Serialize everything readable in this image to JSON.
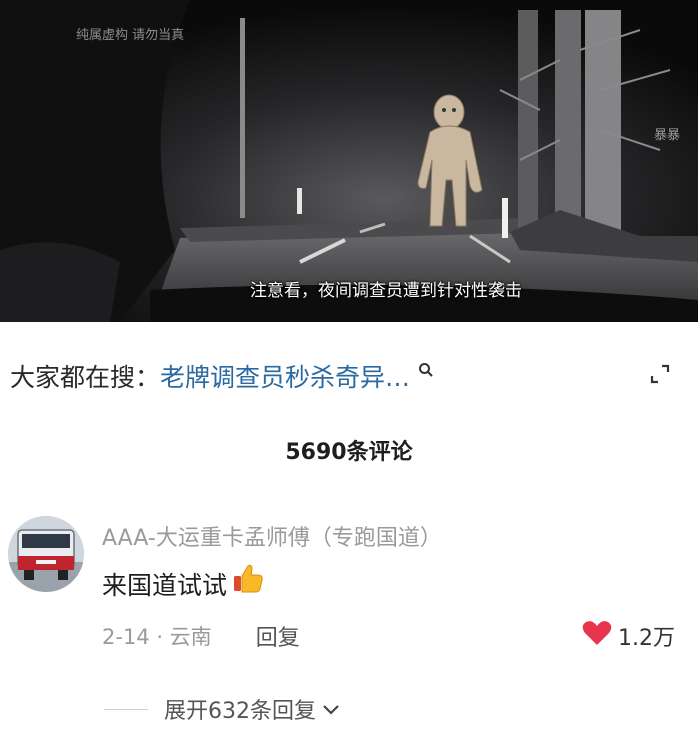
{
  "video": {
    "watermark_left": "纯属虚构 请勿当真",
    "watermark_right": "暴暴",
    "subtitle": "注意看，夜间调查员遭到针对性袭击"
  },
  "search": {
    "prefix": "大家都在搜：",
    "keyword": "老牌调查员秒杀奇异…",
    "icon": "search-icon"
  },
  "comments": {
    "count_label": "5690条评论",
    "items": [
      {
        "username": "AAA-大运重卡孟师傅（专跑国道）",
        "text": "来国道试试",
        "emoji": "thumbs-up-icon",
        "date_location": "2-14 · 云南",
        "reply_label": "回复",
        "like_count": "1.2万",
        "expand_replies": "展开632条回复"
      }
    ]
  },
  "colors": {
    "link_blue": "#2a6aa0",
    "like_red": "#e8344e",
    "muted_gray": "#9a9a9a"
  }
}
